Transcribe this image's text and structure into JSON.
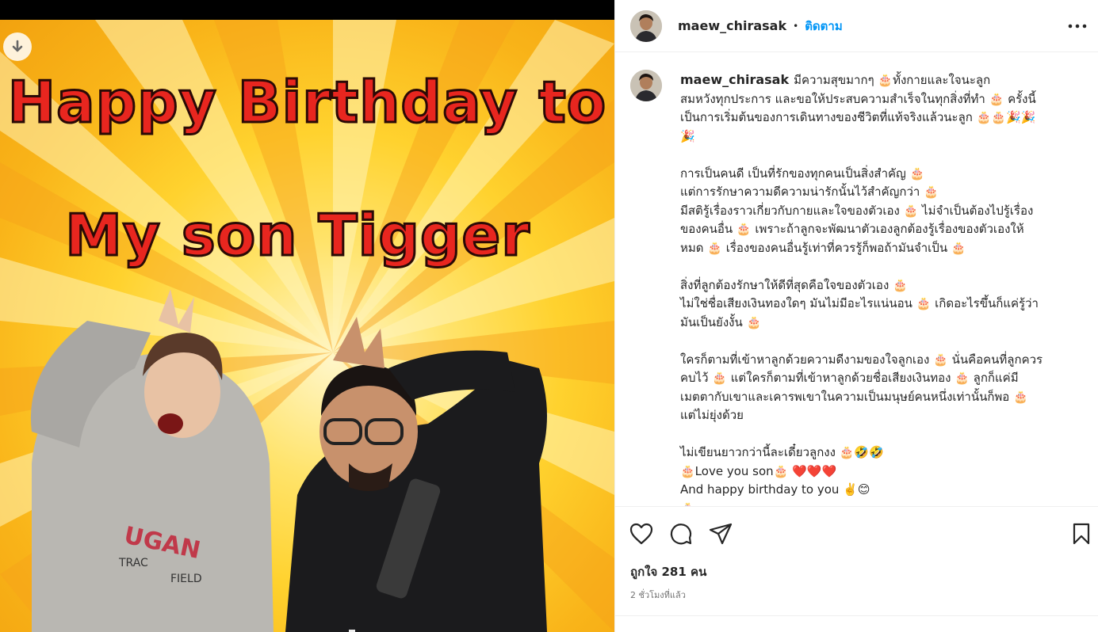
{
  "post": {
    "headline_line1": "Happy Birthday to",
    "headline_line2": "My son Tigger"
  },
  "header": {
    "username": "maew_chirasak",
    "separator": "•",
    "follow_label": "ติดตาม"
  },
  "caption": {
    "username": "maew_chirasak",
    "paragraphs": [
      "มีความสุขมากๆ 🎂ทั้งกายและใจนะลูก\nสมหวังทุกประการ และขอให้ประสบความสำเร็จในทุกสิ่งที่ทำ 🎂 ครั้งนี้\nเป็นการเริ่มต้นของการเดินทางของชีวิตที่แท้จริงแล้วนะลูก 🎂🎂🎉🎉\n🎉",
      "การเป็นคนดี เป็นที่รักของทุกคนเป็นสิ่งสำคัญ 🎂\nแต่การรักษาความดีความน่ารักนั้นไว้สำคัญกว่า 🎂\nมีสติรู้เรื่องราวเกี่ยวกับกายและใจของตัวเอง 🎂 ไม่จำเป็นต้องไปรู้เรื่อง\nของคนอื่น 🎂 เพราะถ้าลูกจะพัฒนาตัวเองลูกต้องรู้เรื่องของตัวเองให้\nหมด 🎂 เรื่องของคนอื่นรู้เท่าที่ควรรู้ก็พอถ้ามันจำเป็น 🎂",
      "สิ่งที่ลูกต้องรักษาให้ดีที่สุดคือใจของตัวเอง 🎂\nไม่ใช่ชื่อเสียงเงินทองใดๆ มันไม่มีอะไรแน่นอน 🎂 เกิดอะไรขึ้นก็แค่รู้ว่า\nมันเป็นยังงั้น 🎂",
      "ใครก็ตามที่เข้าหาลูกด้วยความดีงามของใจลูกเอง 🎂 นั่นคือคนที่ลูกควร\nคบไว้ 🎂 แต่ใครก็ตามที่เข้าหาลูกด้วยชื่อเสียงเงินทอง 🎂 ลูกก็แค่มี\nเมตตากับเขาและเคารพเขาในความเป็นมนุษย์คนหนึ่งเท่านั้นก็พอ 🎂\nแต่ไม่ยุ่งด้วย",
      "ไม่เขียนยาวกว่านี้ละเดี๋ยวลูกงง 🎂🤣🤣\n🎂Love you son🎂 ❤️❤️❤️\nAnd happy birthday to you ✌️😊\n🎂"
    ]
  },
  "actions": {
    "likes_text": "ถูกใจ 281 คน",
    "time_text": "2 ชั่วโมงที่แล้ว"
  },
  "icons": [
    "download-icon",
    "more-icon",
    "heart-icon",
    "comment-icon",
    "share-icon",
    "bookmark-icon"
  ],
  "colors": {
    "accent": "#0095f6",
    "headline_red": "#e8261f",
    "poster_yellow": "#ffd22e"
  }
}
